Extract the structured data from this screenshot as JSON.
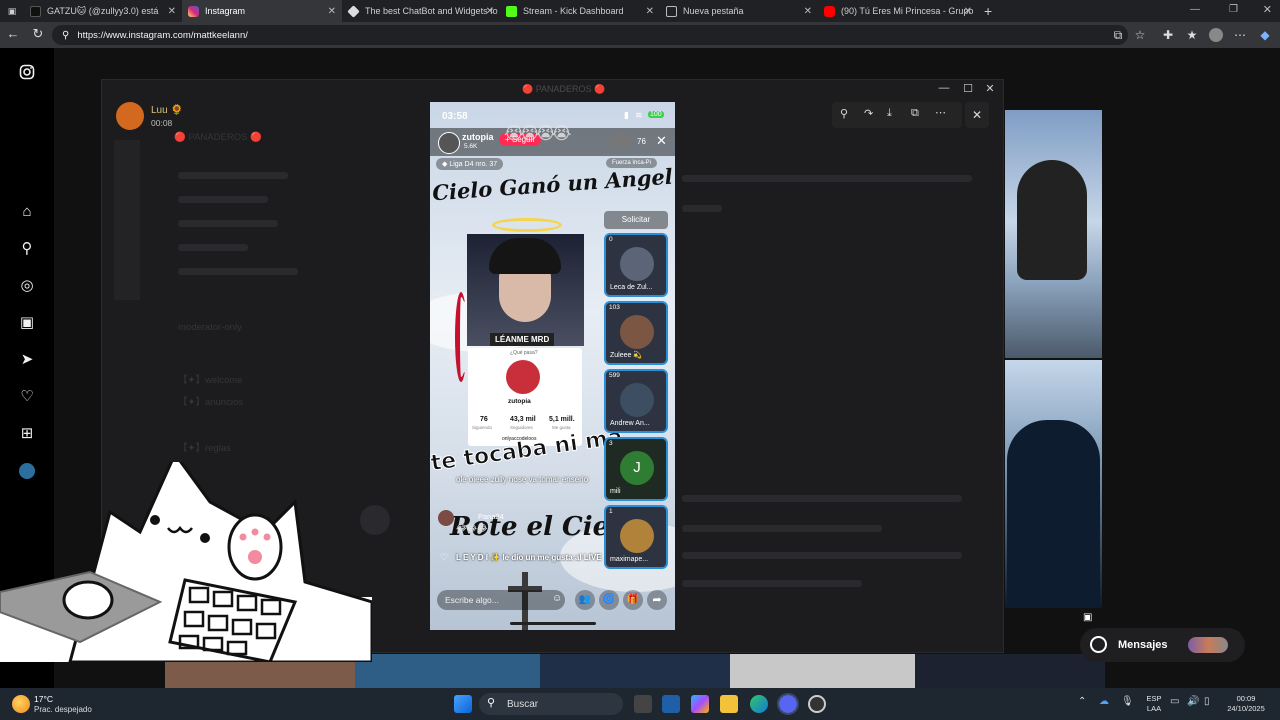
{
  "tabs": [
    {
      "title": "GATZU🐱 (@zullyy3.0) está",
      "color": "#111111"
    },
    {
      "title": "Instagram",
      "color": "#d6249f"
    },
    {
      "title": "The best ChatBot and Widgets fo",
      "color": "#444444"
    },
    {
      "title": "Stream - Kick Dashboard",
      "color": "#53fc18"
    },
    {
      "title": "Nueva pestaña",
      "color": "#666666"
    },
    {
      "title": "(90) Tú Eres Mi Princesa - Grupo",
      "color": "#ff0000"
    }
  ],
  "url": "https://www.instagram.com/mattkeelann/",
  "discord": {
    "user": "Luu 🌻",
    "time": "00:08",
    "server": "🔴 PANADEROS 🔴",
    "channels": [
      "moderator-only",
      "【✦】welcome",
      "【✦】anuncios",
      "【✦】reglas"
    ]
  },
  "live": {
    "clock": "03:58",
    "battery": "100",
    "host": "zutopia",
    "likes": "5.6K",
    "follow": "+ Seguir",
    "viewers": "76",
    "league": "Liga D4 nro. 37",
    "fuerza": "Fuerza Inca-Pi",
    "solicitar": "Solicitar",
    "caption_top": "Cielo Ganó un Angel",
    "caption_mid": "te tocaba ni ma",
    "caption_bot": "Rote el Cie",
    "sticker": "LÉANME MRD",
    "profile": {
      "question": "¿Qué pasa?",
      "name": "zutopia",
      "f1": "76",
      "f1l": "Siguiendo",
      "f2": "43,3 mil",
      "f2l": "Seguidores",
      "f3": "5,1 mill.",
      "f3l": "Me gusta",
      "bio": "onlyaccodeloos"
    },
    "comment1": "ole oieee zully nose va tomar enserio",
    "comment2_user": "Pana24",
    "comment2_emoji": "😂😂😂",
    "gift_user": "L E Y D I ✨",
    "gift_text": "le dio un me gusta al LIVE",
    "input_placeholder": "Escribe algo...",
    "guests": [
      {
        "count": "0",
        "name": "Leca de Zul..."
      },
      {
        "count": "103",
        "name": "Zuleee 💫"
      },
      {
        "count": "599",
        "name": "Andrew An..."
      },
      {
        "count": "3",
        "name": "mili",
        "initial": "J"
      },
      {
        "count": "1",
        "name": "maximape..."
      }
    ]
  },
  "messages_label": "Mensajes",
  "weather": {
    "temp": "17°C",
    "desc": "Prac. despejado"
  },
  "taskbar_search": "Buscar",
  "tray": {
    "lang1": "ESP",
    "lang2": "LAA",
    "time": "00:09",
    "date": "24/10/2025"
  },
  "colors": {
    "accent": "#fe2c55",
    "guest_border": "#2a8fd6",
    "win_blue": "#0078d4"
  }
}
